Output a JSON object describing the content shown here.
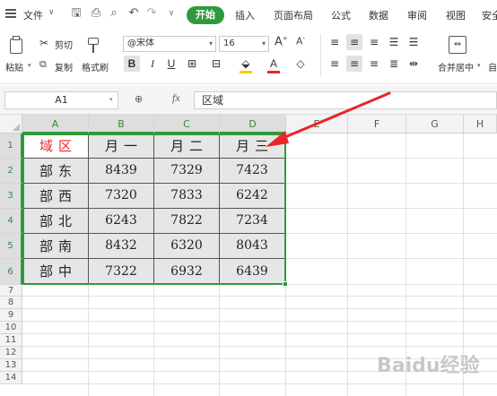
{
  "menubar": {
    "file": "文件",
    "tabs": [
      "开始",
      "插入",
      "页面布局",
      "公式",
      "数据",
      "审阅",
      "视图",
      "安全"
    ]
  },
  "ribbon": {
    "paste": "粘贴",
    "cut": "剪切",
    "copy": "复制",
    "format_painter": "格式刷",
    "font_name": "@宋体",
    "font_size": "16",
    "merge_center": "合并居中",
    "auto": "自"
  },
  "formula_bar": {
    "cell_ref": "A1",
    "fx": "fx",
    "value": "区域"
  },
  "grid": {
    "columns": [
      "A",
      "B",
      "C",
      "D",
      "E",
      "F",
      "G",
      "H"
    ],
    "rows": [
      "1",
      "2",
      "3",
      "4",
      "5",
      "6",
      "7",
      "8",
      "9",
      "10",
      "11",
      "12",
      "13",
      "14"
    ],
    "header": [
      "区域",
      "一月",
      "二月",
      "三月"
    ],
    "data": [
      {
        "region": "东部",
        "values": [
          "8439",
          "7329",
          "7423"
        ]
      },
      {
        "region": "西部",
        "values": [
          "7320",
          "7833",
          "6242"
        ]
      },
      {
        "region": "北部",
        "values": [
          "6243",
          "7822",
          "7234"
        ]
      },
      {
        "region": "南部",
        "values": [
          "8432",
          "6320",
          "8043"
        ]
      },
      {
        "region": "中部",
        "values": [
          "7322",
          "6932",
          "6439"
        ]
      }
    ]
  },
  "watermark": "Baidu经验",
  "colors": {
    "accent": "#2e9a3c",
    "arrow": "#e8262b",
    "header_text": "#e8262b"
  }
}
